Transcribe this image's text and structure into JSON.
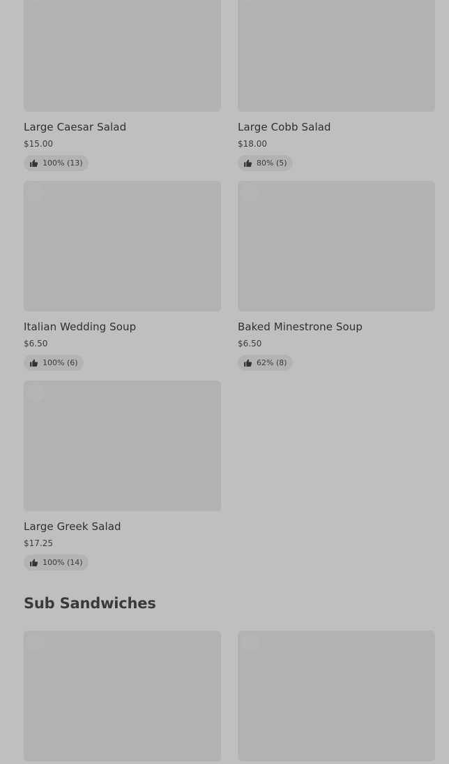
{
  "items": [
    {
      "name": "Large Caesar Salad",
      "price": "$15.00",
      "rating": "100% (13)"
    },
    {
      "name": "Large Cobb Salad",
      "price": "$18.00",
      "rating": "80% (5)"
    },
    {
      "name": "Italian Wedding Soup",
      "price": "$6.50",
      "rating": "100% (6)"
    },
    {
      "name": "Baked Minestrone Soup",
      "price": "$6.50",
      "rating": "62% (8)"
    },
    {
      "name": "Large Greek Salad",
      "price": "$17.25",
      "rating": "100% (14)"
    }
  ],
  "sections": {
    "sub_sandwiches": {
      "title": "Sub Sandwiches"
    }
  },
  "icons": {
    "rating": "thumbs-up-icon"
  },
  "colors": {
    "background": "#bfbfbf",
    "image_placeholder": "#b2b2b2",
    "rating_pill": "#b3b3b3",
    "text": "#333333"
  }
}
